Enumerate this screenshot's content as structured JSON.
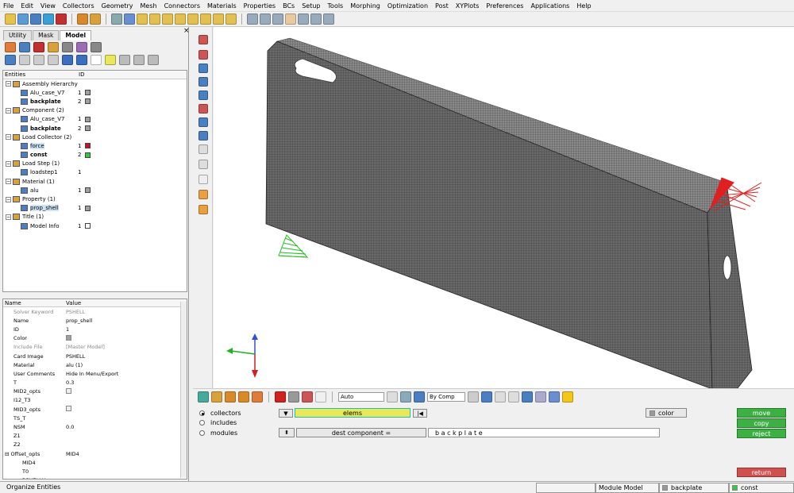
{
  "menu": [
    "File",
    "Edit",
    "View",
    "Collectors",
    "Geometry",
    "Mesh",
    "Connectors",
    "Materials",
    "Properties",
    "BCs",
    "Setup",
    "Tools",
    "Morphing",
    "Optimization",
    "Post",
    "XYPlots",
    "Preferences",
    "Applications",
    "Help"
  ],
  "tabs": [
    "Utility",
    "Mask",
    "Model"
  ],
  "tree": {
    "header": {
      "entities": "Entities",
      "id": "ID"
    },
    "rows": [
      {
        "level": 0,
        "label": "Assembly Hierarchy",
        "exp": "−"
      },
      {
        "level": 1,
        "label": "Alu_case_V7",
        "id": "1",
        "color": "#a0a0a0"
      },
      {
        "level": 1,
        "label": "backplate",
        "id": "2",
        "color": "#a0a0a0",
        "bold": true
      },
      {
        "level": 0,
        "label": "Component (2)",
        "exp": "−"
      },
      {
        "level": 1,
        "label": "Alu_case_V7",
        "id": "1",
        "color": "#a0a0a0"
      },
      {
        "level": 1,
        "label": "backplate",
        "id": "2",
        "color": "#a0a0a0",
        "bold": true
      },
      {
        "level": 0,
        "label": "Load Collector (2)",
        "exp": "−"
      },
      {
        "level": 1,
        "label": "force",
        "id": "1",
        "color": "#c8102e",
        "sel": true
      },
      {
        "level": 1,
        "label": "const",
        "id": "2",
        "color": "#2ecc40",
        "bold": true
      },
      {
        "level": 0,
        "label": "Load Step (1)",
        "exp": "−"
      },
      {
        "level": 1,
        "label": "loadstep1",
        "id": "1"
      },
      {
        "level": 0,
        "label": "Material (1)",
        "exp": "−"
      },
      {
        "level": 1,
        "label": "alu",
        "id": "1",
        "color": "#a0a0a0"
      },
      {
        "level": 0,
        "label": "Property (1)",
        "exp": "−"
      },
      {
        "level": 1,
        "label": "prop_shell",
        "id": "1",
        "color": "#a0a0a0",
        "sel": true
      },
      {
        "level": 0,
        "label": "Title (1)",
        "exp": "−"
      },
      {
        "level": 1,
        "label": "Model Info",
        "id": "1",
        "color": "#ffffff"
      }
    ]
  },
  "props": {
    "header": {
      "name": "Name",
      "value": "Value"
    },
    "rows": [
      {
        "name": "Solver Keyword",
        "value": "PSHELL",
        "grey": true
      },
      {
        "name": "Name",
        "value": "prop_shell"
      },
      {
        "name": "ID",
        "value": "1"
      },
      {
        "name": "Color",
        "value": "",
        "swatch": true
      },
      {
        "name": "Include File",
        "value": "[Master Model]",
        "grey": true
      },
      {
        "name": "Card Image",
        "value": "PSHELL"
      },
      {
        "name": "Material",
        "value": "alu (1)"
      },
      {
        "name": "User Comments",
        "value": "Hide In Menu/Export"
      },
      {
        "name": "T",
        "value": "0.3"
      },
      {
        "name": "MID2_opts",
        "value": "",
        "check": true
      },
      {
        "name": "I12_T3",
        "value": ""
      },
      {
        "name": "MID3_opts",
        "value": "",
        "check": true
      },
      {
        "name": "TS_T",
        "value": ""
      },
      {
        "name": "NSM",
        "value": "0.0"
      },
      {
        "name": "Z1",
        "value": ""
      },
      {
        "name": "Z2",
        "value": ""
      },
      {
        "name": "Offset_opts",
        "value": "MID4",
        "exp": true
      },
      {
        "name": "MID4",
        "value": "",
        "indent": true
      },
      {
        "name": "T0",
        "value": "",
        "indent": true
      },
      {
        "name": "PCHELLX",
        "value": "",
        "indent": true
      }
    ]
  },
  "bottom_toolbar": {
    "auto": "Auto",
    "bycomp": "By Comp"
  },
  "panel": {
    "radios": [
      "collectors",
      "includes",
      "modules"
    ],
    "elems": "elems",
    "dest": "dest component =",
    "dest_value": "b a c k p l a t e",
    "color_btn": "color",
    "move": "move",
    "copy": "copy",
    "reject": "reject",
    "return": "return"
  },
  "status": {
    "left": "Organize Entities",
    "module": "Module Model",
    "component": "backplate",
    "loadcol": "const"
  }
}
